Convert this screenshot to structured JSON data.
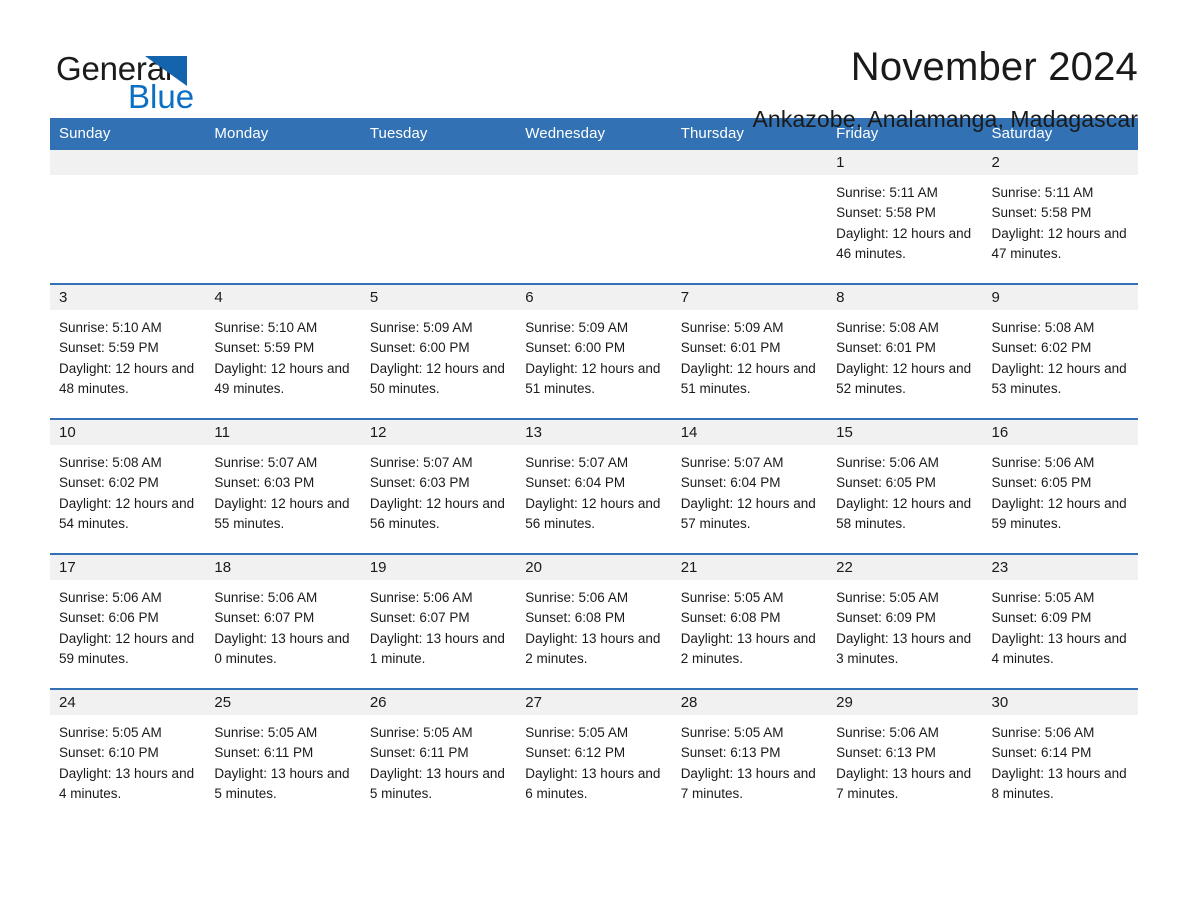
{
  "brand": {
    "name_part1": "General",
    "name_part2": "Blue",
    "triangle_color": "#1464ad",
    "blue_color": "#0b6fc4"
  },
  "header": {
    "month_title": "November 2024",
    "location": "Ankazobe, Analamanga, Madagascar"
  },
  "calendar": {
    "header_bg": "#3272b4",
    "daynum_bg": "#f1f1f1",
    "weekday_headers": [
      "Sunday",
      "Monday",
      "Tuesday",
      "Wednesday",
      "Thursday",
      "Friday",
      "Saturday"
    ],
    "weeks": [
      [
        {
          "day": ""
        },
        {
          "day": ""
        },
        {
          "day": ""
        },
        {
          "day": ""
        },
        {
          "day": ""
        },
        {
          "day": "1",
          "sunrise": "Sunrise: 5:11 AM",
          "sunset": "Sunset: 5:58 PM",
          "daylight": "Daylight: 12 hours and 46 minutes."
        },
        {
          "day": "2",
          "sunrise": "Sunrise: 5:11 AM",
          "sunset": "Sunset: 5:58 PM",
          "daylight": "Daylight: 12 hours and 47 minutes."
        }
      ],
      [
        {
          "day": "3",
          "sunrise": "Sunrise: 5:10 AM",
          "sunset": "Sunset: 5:59 PM",
          "daylight": "Daylight: 12 hours and 48 minutes."
        },
        {
          "day": "4",
          "sunrise": "Sunrise: 5:10 AM",
          "sunset": "Sunset: 5:59 PM",
          "daylight": "Daylight: 12 hours and 49 minutes."
        },
        {
          "day": "5",
          "sunrise": "Sunrise: 5:09 AM",
          "sunset": "Sunset: 6:00 PM",
          "daylight": "Daylight: 12 hours and 50 minutes."
        },
        {
          "day": "6",
          "sunrise": "Sunrise: 5:09 AM",
          "sunset": "Sunset: 6:00 PM",
          "daylight": "Daylight: 12 hours and 51 minutes."
        },
        {
          "day": "7",
          "sunrise": "Sunrise: 5:09 AM",
          "sunset": "Sunset: 6:01 PM",
          "daylight": "Daylight: 12 hours and 51 minutes."
        },
        {
          "day": "8",
          "sunrise": "Sunrise: 5:08 AM",
          "sunset": "Sunset: 6:01 PM",
          "daylight": "Daylight: 12 hours and 52 minutes."
        },
        {
          "day": "9",
          "sunrise": "Sunrise: 5:08 AM",
          "sunset": "Sunset: 6:02 PM",
          "daylight": "Daylight: 12 hours and 53 minutes."
        }
      ],
      [
        {
          "day": "10",
          "sunrise": "Sunrise: 5:08 AM",
          "sunset": "Sunset: 6:02 PM",
          "daylight": "Daylight: 12 hours and 54 minutes."
        },
        {
          "day": "11",
          "sunrise": "Sunrise: 5:07 AM",
          "sunset": "Sunset: 6:03 PM",
          "daylight": "Daylight: 12 hours and 55 minutes."
        },
        {
          "day": "12",
          "sunrise": "Sunrise: 5:07 AM",
          "sunset": "Sunset: 6:03 PM",
          "daylight": "Daylight: 12 hours and 56 minutes."
        },
        {
          "day": "13",
          "sunrise": "Sunrise: 5:07 AM",
          "sunset": "Sunset: 6:04 PM",
          "daylight": "Daylight: 12 hours and 56 minutes."
        },
        {
          "day": "14",
          "sunrise": "Sunrise: 5:07 AM",
          "sunset": "Sunset: 6:04 PM",
          "daylight": "Daylight: 12 hours and 57 minutes."
        },
        {
          "day": "15",
          "sunrise": "Sunrise: 5:06 AM",
          "sunset": "Sunset: 6:05 PM",
          "daylight": "Daylight: 12 hours and 58 minutes."
        },
        {
          "day": "16",
          "sunrise": "Sunrise: 5:06 AM",
          "sunset": "Sunset: 6:05 PM",
          "daylight": "Daylight: 12 hours and 59 minutes."
        }
      ],
      [
        {
          "day": "17",
          "sunrise": "Sunrise: 5:06 AM",
          "sunset": "Sunset: 6:06 PM",
          "daylight": "Daylight: 12 hours and 59 minutes."
        },
        {
          "day": "18",
          "sunrise": "Sunrise: 5:06 AM",
          "sunset": "Sunset: 6:07 PM",
          "daylight": "Daylight: 13 hours and 0 minutes."
        },
        {
          "day": "19",
          "sunrise": "Sunrise: 5:06 AM",
          "sunset": "Sunset: 6:07 PM",
          "daylight": "Daylight: 13 hours and 1 minute."
        },
        {
          "day": "20",
          "sunrise": "Sunrise: 5:06 AM",
          "sunset": "Sunset: 6:08 PM",
          "daylight": "Daylight: 13 hours and 2 minutes."
        },
        {
          "day": "21",
          "sunrise": "Sunrise: 5:05 AM",
          "sunset": "Sunset: 6:08 PM",
          "daylight": "Daylight: 13 hours and 2 minutes."
        },
        {
          "day": "22",
          "sunrise": "Sunrise: 5:05 AM",
          "sunset": "Sunset: 6:09 PM",
          "daylight": "Daylight: 13 hours and 3 minutes."
        },
        {
          "day": "23",
          "sunrise": "Sunrise: 5:05 AM",
          "sunset": "Sunset: 6:09 PM",
          "daylight": "Daylight: 13 hours and 4 minutes."
        }
      ],
      [
        {
          "day": "24",
          "sunrise": "Sunrise: 5:05 AM",
          "sunset": "Sunset: 6:10 PM",
          "daylight": "Daylight: 13 hours and 4 minutes."
        },
        {
          "day": "25",
          "sunrise": "Sunrise: 5:05 AM",
          "sunset": "Sunset: 6:11 PM",
          "daylight": "Daylight: 13 hours and 5 minutes."
        },
        {
          "day": "26",
          "sunrise": "Sunrise: 5:05 AM",
          "sunset": "Sunset: 6:11 PM",
          "daylight": "Daylight: 13 hours and 5 minutes."
        },
        {
          "day": "27",
          "sunrise": "Sunrise: 5:05 AM",
          "sunset": "Sunset: 6:12 PM",
          "daylight": "Daylight: 13 hours and 6 minutes."
        },
        {
          "day": "28",
          "sunrise": "Sunrise: 5:05 AM",
          "sunset": "Sunset: 6:13 PM",
          "daylight": "Daylight: 13 hours and 7 minutes."
        },
        {
          "day": "29",
          "sunrise": "Sunrise: 5:06 AM",
          "sunset": "Sunset: 6:13 PM",
          "daylight": "Daylight: 13 hours and 7 minutes."
        },
        {
          "day": "30",
          "sunrise": "Sunrise: 5:06 AM",
          "sunset": "Sunset: 6:14 PM",
          "daylight": "Daylight: 13 hours and 8 minutes."
        }
      ]
    ]
  }
}
